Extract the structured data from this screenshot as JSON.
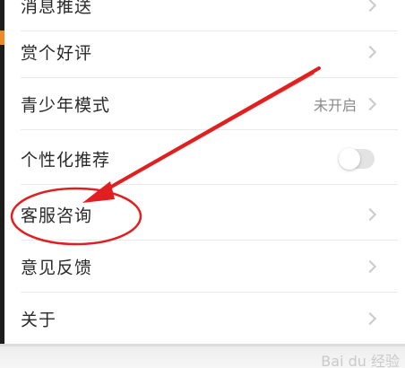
{
  "settings": {
    "items": [
      {
        "label": "消息推送",
        "type": "link"
      },
      {
        "label": "赏个好评",
        "type": "link"
      },
      {
        "label": "青少年模式",
        "type": "link",
        "value": "未开启"
      },
      {
        "label": "个性化推荐",
        "type": "toggle",
        "toggle_on": false
      },
      {
        "label": "客服咨询",
        "type": "link"
      },
      {
        "label": "意见反馈",
        "type": "link"
      },
      {
        "label": "关于",
        "type": "link"
      }
    ]
  },
  "annotation": {
    "arrow_color": "#e02020",
    "circle_color": "#e02020",
    "highlighted_item": "客服咨询"
  },
  "watermark": {
    "text": "Bai du 经验"
  },
  "colors": {
    "text": "#2a2a2a",
    "muted": "#8a8a8a",
    "divider": "#e9e9e9",
    "chevron": "#c9c9c9",
    "toggle_track": "#e3e3e3"
  }
}
